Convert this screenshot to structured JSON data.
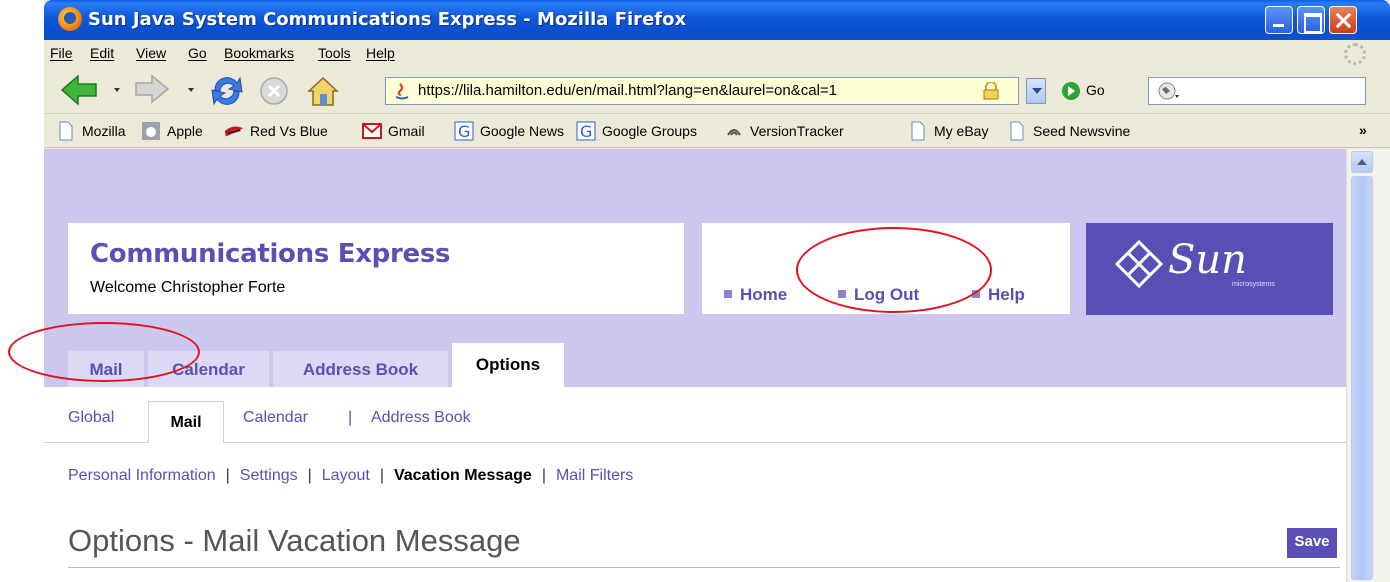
{
  "window": {
    "title": "Sun Java System Communications Express - Mozilla Firefox"
  },
  "menubar": {
    "items": [
      "File",
      "Edit",
      "View",
      "Go",
      "Bookmarks",
      "Tools",
      "Help"
    ]
  },
  "navbar": {
    "url": "https://lila.hamilton.edu/en/mail.html?lang=en&laurel=on&cal=1",
    "go_label": "Go"
  },
  "bookmarks": {
    "items": [
      {
        "label": "Mozilla",
        "icon": "page-icon"
      },
      {
        "label": "Apple",
        "icon": "apple-icon"
      },
      {
        "label": "Red Vs Blue",
        "icon": "redvsblue-icon"
      },
      {
        "label": "Gmail",
        "icon": "gmail-icon"
      },
      {
        "label": "Google News",
        "icon": "google-icon"
      },
      {
        "label": "Google Groups",
        "icon": "google-icon"
      },
      {
        "label": "VersionTracker",
        "icon": "versiontracker-icon"
      },
      {
        "label": "My eBay",
        "icon": "page-icon"
      },
      {
        "label": "Seed Newsvine",
        "icon": "page-icon"
      }
    ],
    "more": "»"
  },
  "app": {
    "brand_title": "Communications Express",
    "welcome": "Welcome Christopher Forte",
    "top_links": [
      "Home",
      "Log Out",
      "Help"
    ],
    "sun_word": "Sun",
    "sun_sub": "microsystems",
    "tabs": [
      "Mail",
      "Calendar",
      "Address Book",
      "Options"
    ],
    "active_tab": "Options",
    "subtabs": [
      "Global",
      "Mail",
      "Calendar",
      "Address Book"
    ],
    "active_subtab": "Mail",
    "sublinks": [
      "Personal Information",
      "Settings",
      "Layout",
      "Vacation Message",
      "Mail Filters"
    ],
    "active_sublink": "Vacation Message",
    "page_title": "Options - Mail Vacation Message",
    "save_label": "Save"
  },
  "colors": {
    "brand_purple": "#5b4eb5",
    "banner_bg": "#cbc7ef",
    "link": "#5a4fb2",
    "annotation_red": "#e2121d"
  }
}
